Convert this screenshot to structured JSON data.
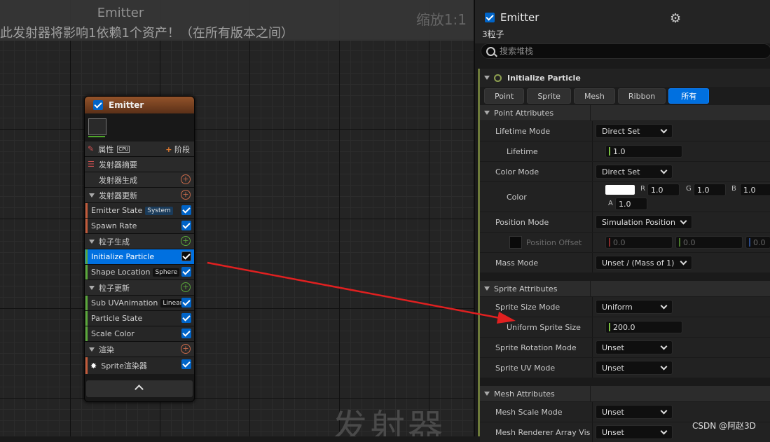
{
  "graph": {
    "title": "Emitter",
    "warning": "此发射器将影响1依赖1个资产！（在所有版本之间）",
    "zoom": "缩放1:1",
    "watermark": "发射器"
  },
  "node": {
    "title": "Emitter",
    "properties_label": "属性",
    "cpu_tag": "CPU",
    "stage_label": "阶段",
    "summary_label": "发射器摘要",
    "rows": [
      {
        "label": "发射器生成"
      },
      {
        "label": "发射器更新"
      },
      {
        "label": "Emitter State",
        "tag": "System"
      },
      {
        "label": "Spawn Rate"
      },
      {
        "label": "粒子生成"
      },
      {
        "label": "Initialize Particle"
      },
      {
        "label": "Shape Location",
        "tag": "Sphere"
      },
      {
        "label": "粒子更新"
      },
      {
        "label": "Sub UVAnimation",
        "tag": "Linear"
      },
      {
        "label": "Particle State"
      },
      {
        "label": "Scale Color"
      },
      {
        "label": "渲染"
      },
      {
        "label": "Sprite渲染器"
      }
    ]
  },
  "panel": {
    "title": "Emitter",
    "subtitle": "3粒子",
    "search_placeholder": "搜索堆栈",
    "module_title": "Initialize Particle",
    "filters": [
      "Point",
      "Sprite",
      "Mesh",
      "Ribbon",
      "所有"
    ],
    "point_attributes": "Point Attributes",
    "lifetime_mode": {
      "label": "Lifetime Mode",
      "value": "Direct Set"
    },
    "lifetime": {
      "label": "Lifetime",
      "value": "1.0"
    },
    "color_mode": {
      "label": "Color Mode",
      "value": "Direct Set"
    },
    "color": {
      "label": "Color",
      "r": "1.0",
      "g": "1.0",
      "b": "1.0",
      "a": "1.0",
      "r_label": "R",
      "g_label": "G",
      "b_label": "B",
      "a_label": "A"
    },
    "position_mode": {
      "label": "Position Mode",
      "value": "Simulation Position"
    },
    "position_offset": {
      "label": "Position Offset",
      "x": "0.0",
      "y": "0.0",
      "z": "0.0"
    },
    "mass_mode": {
      "label": "Mass Mode",
      "value": "Unset / (Mass of 1)"
    },
    "sprite_attributes": "Sprite Attributes",
    "sprite_size_mode": {
      "label": "Sprite Size Mode",
      "value": "Uniform"
    },
    "uniform_sprite_size": {
      "label": "Uniform Sprite Size",
      "value": "200.0"
    },
    "sprite_rotation_mode": {
      "label": "Sprite Rotation Mode",
      "value": "Unset"
    },
    "sprite_uv_mode": {
      "label": "Sprite UV Mode",
      "value": "Unset"
    },
    "mesh_attributes": "Mesh Attributes",
    "mesh_scale_mode": {
      "label": "Mesh Scale Mode",
      "value": "Unset"
    },
    "mesh_renderer_array": {
      "label": "Mesh Renderer Array Visi",
      "value": "Unset"
    }
  },
  "credit": "CSDN @阿赵3D",
  "colors": {
    "accent": "#0070e0",
    "arrow": "#e02020",
    "emitter_header": "#93532a"
  }
}
